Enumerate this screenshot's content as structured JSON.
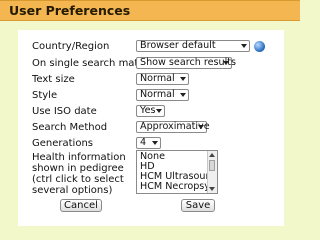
{
  "header": {
    "title": "User Preferences"
  },
  "fields": [
    {
      "label": "Country/Region",
      "value": "Browser default"
    },
    {
      "label": "On single search match",
      "value": "Show search results"
    },
    {
      "label": "Text size",
      "value": "Normal"
    },
    {
      "label": "Style",
      "value": "Normal"
    },
    {
      "label": "Use ISO date",
      "value": "Yes"
    },
    {
      "label": "Search Method",
      "value": "Approximative"
    },
    {
      "label": "Generations",
      "value": "4"
    }
  ],
  "health": {
    "label_lines": [
      "Health information",
      "shown in pedigree",
      "(ctrl click to select",
      "several options)"
    ],
    "options": [
      "None",
      "HD",
      "HCM Ultrasound",
      "HCM Necropsy"
    ]
  },
  "buttons": {
    "cancel": "Cancel",
    "save": "Save"
  },
  "icons": {
    "globe": "globe-icon"
  },
  "colors": {
    "background": "#f2f8c9",
    "header": "#f4b650",
    "panel": "#ffffff"
  }
}
